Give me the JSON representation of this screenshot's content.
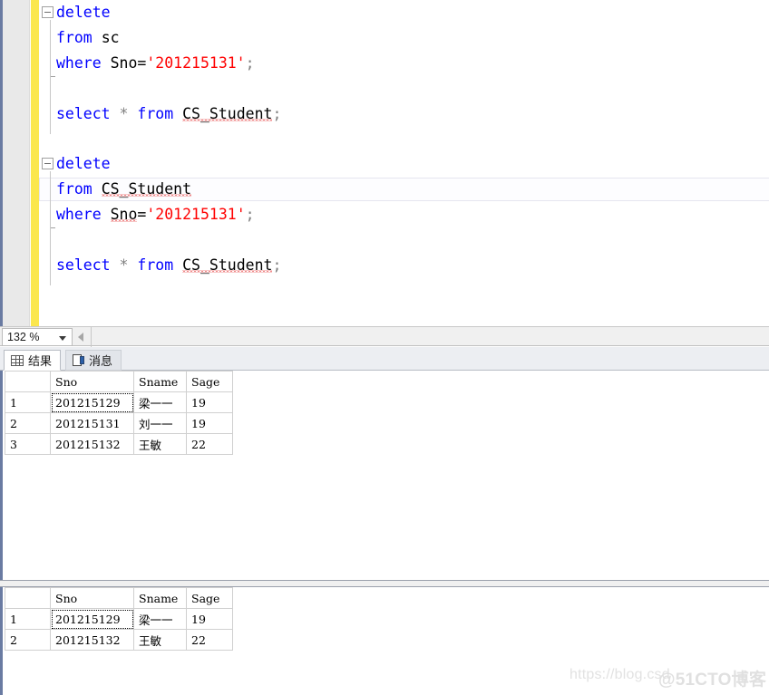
{
  "editor": {
    "zoom_level": "132 %",
    "blocks": [
      {
        "name": "delete-from-sc-block",
        "lines": [
          {
            "indent": 0,
            "tokens": [
              {
                "t": "delete",
                "c": "kw"
              }
            ]
          },
          {
            "indent": 1,
            "tokens": [
              {
                "t": "from",
                "c": "kw"
              },
              {
                "t": " ",
                "c": "idn"
              },
              {
                "t": "sc",
                "c": "idn"
              }
            ]
          },
          {
            "indent": 1,
            "tokens": [
              {
                "t": "where",
                "c": "kw"
              },
              {
                "t": " Sno=",
                "c": "idn"
              },
              {
                "t": "'201215131'",
                "c": "str"
              },
              {
                "t": ";",
                "c": "pun"
              }
            ]
          },
          {
            "indent": 1,
            "tokens": []
          },
          {
            "indent": 1,
            "tokens": [
              {
                "t": "select",
                "c": "kw"
              },
              {
                "t": " ",
                "c": "idn"
              },
              {
                "t": "*",
                "c": "pun"
              },
              {
                "t": " ",
                "c": "idn"
              },
              {
                "t": "from",
                "c": "kw"
              },
              {
                "t": " ",
                "c": "idn"
              },
              {
                "t": "CS_Student",
                "c": "idn sq"
              },
              {
                "t": ";",
                "c": "pun"
              }
            ]
          }
        ]
      },
      {
        "name": "delete-from-cs-student-block",
        "lines": [
          {
            "indent": 0,
            "tokens": [
              {
                "t": "delete",
                "c": "kw"
              }
            ]
          },
          {
            "indent": 1,
            "tokens": [
              {
                "t": "from",
                "c": "kw"
              },
              {
                "t": " ",
                "c": "idn"
              },
              {
                "t": "CS_Student",
                "c": "idn sq"
              }
            ]
          },
          {
            "indent": 1,
            "tokens": [
              {
                "t": "where",
                "c": "kw"
              },
              {
                "t": " ",
                "c": "idn"
              },
              {
                "t": "Sno",
                "c": "idn sq"
              },
              {
                "t": "=",
                "c": "idn"
              },
              {
                "t": "'201215131'",
                "c": "str"
              },
              {
                "t": ";",
                "c": "pun"
              }
            ]
          },
          {
            "indent": 1,
            "tokens": []
          },
          {
            "indent": 1,
            "tokens": [
              {
                "t": "select",
                "c": "kw"
              },
              {
                "t": " ",
                "c": "idn"
              },
              {
                "t": "*",
                "c": "pun"
              },
              {
                "t": " ",
                "c": "idn"
              },
              {
                "t": "from",
                "c": "kw"
              },
              {
                "t": " ",
                "c": "idn"
              },
              {
                "t": "CS_Student",
                "c": "idn sq"
              },
              {
                "t": ";",
                "c": "pun"
              }
            ]
          }
        ]
      }
    ]
  },
  "results_panel": {
    "tabs": [
      {
        "label": "结果",
        "icon": "grid-icon",
        "active": true
      },
      {
        "label": "消息",
        "icon": "message-icon",
        "active": false
      }
    ],
    "grids": [
      {
        "name": "results-grid-1",
        "columns": [
          "",
          "Sno",
          "Sname",
          "Sage"
        ],
        "rows": [
          {
            "n": "1",
            "Sno": "201215129",
            "Sname": "梁一一",
            "Sage": "19"
          },
          {
            "n": "2",
            "Sno": "201215131",
            "Sname": "刘一一",
            "Sage": "19"
          },
          {
            "n": "3",
            "Sno": "201215132",
            "Sname": "王敏",
            "Sage": "22"
          }
        ],
        "selected_cell": {
          "row": 0,
          "column": "Sno"
        }
      },
      {
        "name": "results-grid-2",
        "columns": [
          "",
          "Sno",
          "Sname",
          "Sage"
        ],
        "rows": [
          {
            "n": "1",
            "Sno": "201215129",
            "Sname": "梁一一",
            "Sage": "19"
          },
          {
            "n": "2",
            "Sno": "201215132",
            "Sname": "王敏",
            "Sage": "22"
          }
        ],
        "selected_cell": {
          "row": 0,
          "column": "Sno"
        }
      }
    ]
  },
  "watermark": {
    "url_text": "https://blog.csd",
    "brand_text": "@51CTO博客"
  },
  "colors": {
    "keyword": "#0000ff",
    "string": "#ff0000",
    "punctuation": "#808080",
    "identifier": "#000000",
    "change_bar": "#fbe74d",
    "pane_border": "#6a7ba2",
    "selected_cell": "#dfe6ee",
    "squiggle": "#e01b1b"
  }
}
